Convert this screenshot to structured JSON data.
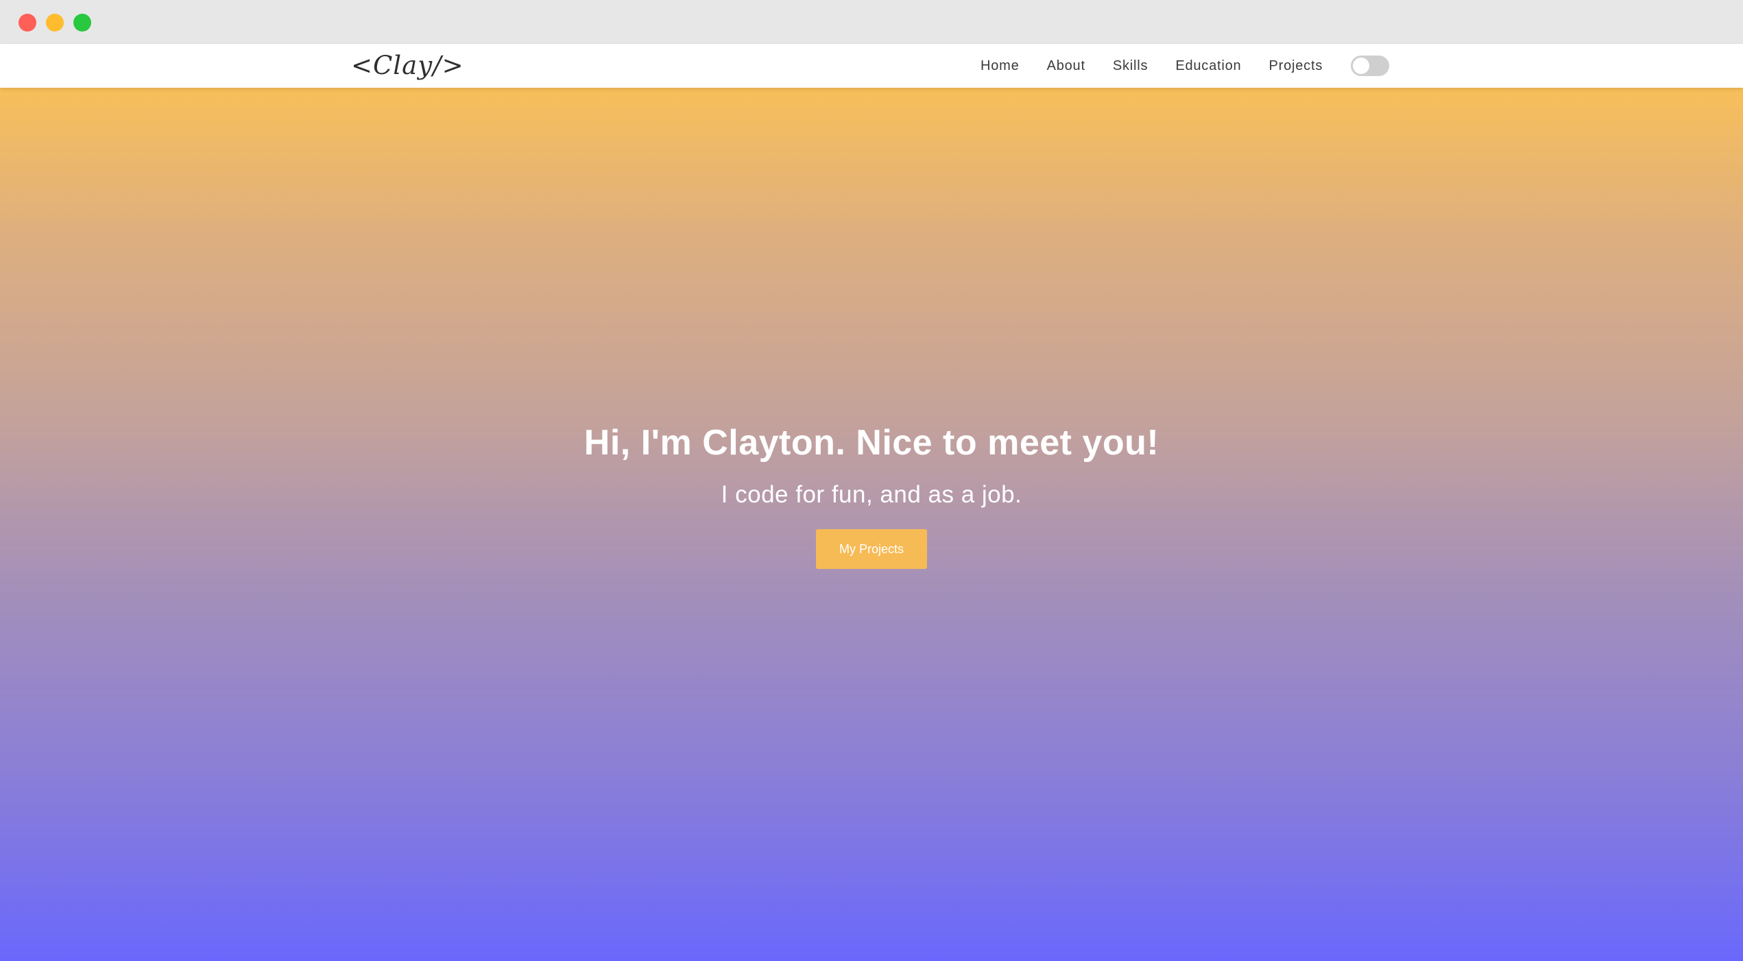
{
  "window": {
    "traffic_lights": [
      "close",
      "minimize",
      "maximize"
    ]
  },
  "navbar": {
    "logo": "<Clay/>",
    "links": [
      "Home",
      "About",
      "Skills",
      "Education",
      "Projects"
    ],
    "theme_toggle": {
      "state": "off"
    }
  },
  "hero": {
    "title": "Hi, I'm Clayton. Nice to meet you!",
    "subtitle": "I code for fun, and as a job.",
    "button_label": "My Projects"
  },
  "colors": {
    "gradient_top": "#f8bf5a",
    "gradient_bottom": "#6a68fc",
    "button": "#f7bb56"
  }
}
